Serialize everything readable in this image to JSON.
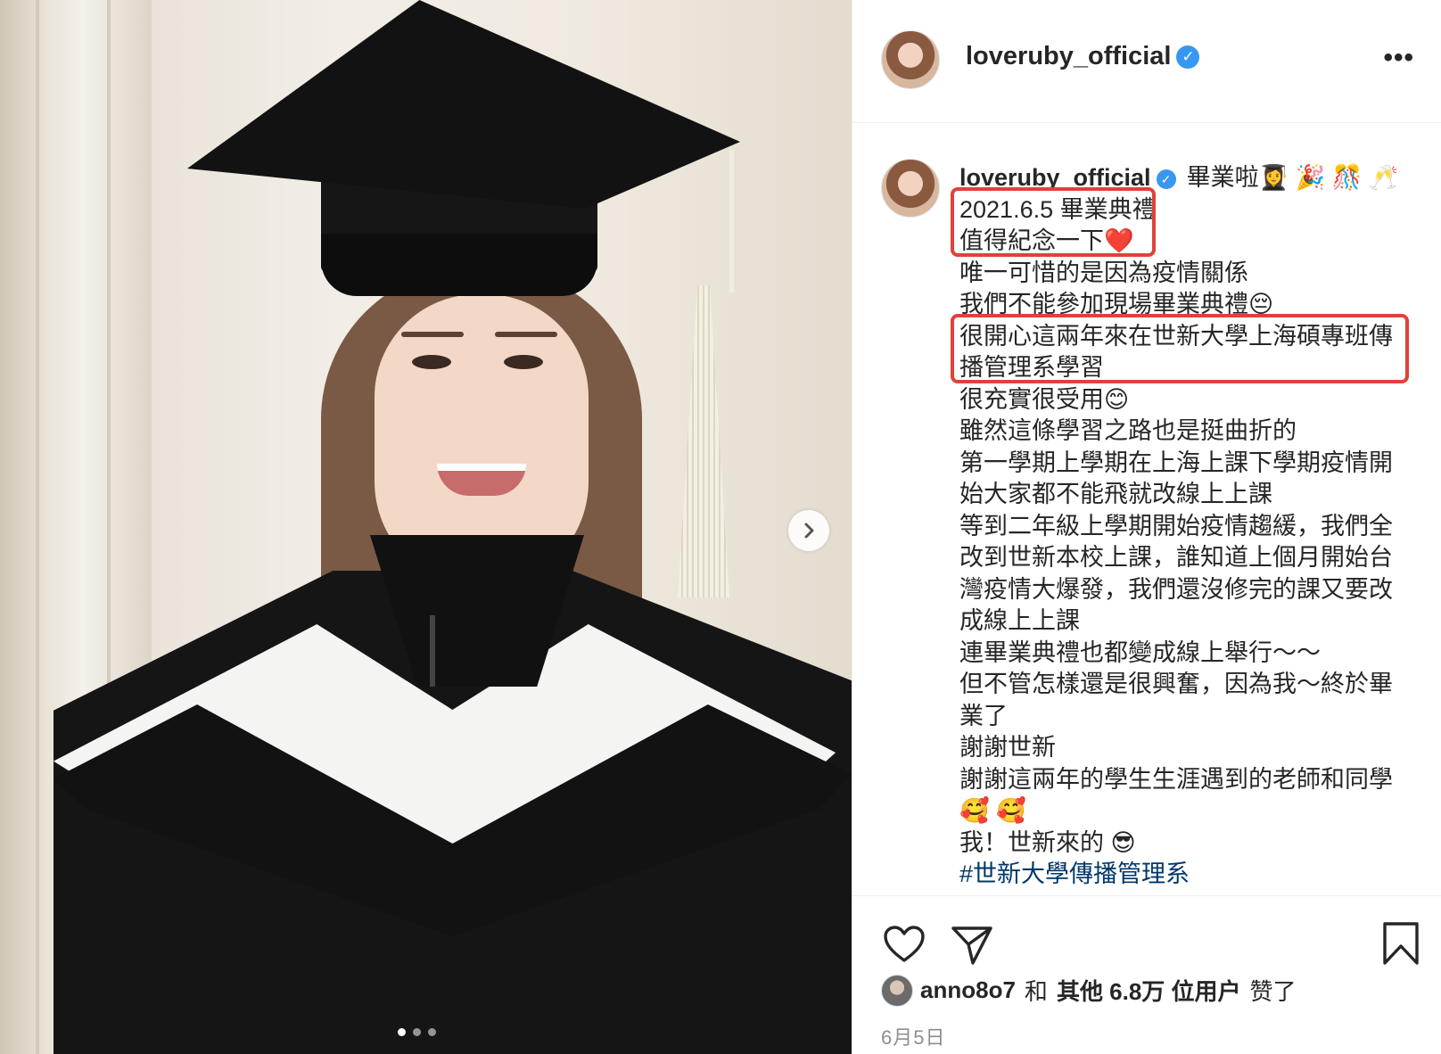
{
  "post": {
    "username": "loveruby_official",
    "verified_badge": "✓",
    "more_label": "•••",
    "caption_lines": [
      "2021.6.5 畢業典禮",
      "值得紀念一下❤️",
      "唯一可惜的是因為疫情關係",
      "我們不能參加現場畢業典禮😔",
      "很開心這兩年來在世新大學上海碩專班傳播管理系學習",
      "很充實很受用😊",
      "雖然這條學習之路也是挺曲折的",
      "第一學期上學期在上海上課下學期疫情開始大家都不能飛就改線上上課",
      "等到二年級上學期開始疫情趨緩，我們全改到世新本校上課，誰知道上個月開始台灣疫情大爆發，我們還沒修完的課又要改成線上上課",
      "連畢業典禮也都變成線上舉行～～",
      "但不管怎樣還是很興奮，因為我～終於畢業了",
      "謝謝世新",
      "謝謝這兩年的學生生涯遇到的老師和同學🥰 🥰",
      "我！世新來的 😎"
    ],
    "caption_first": "畢業啦👩‍🎓 🎉 🎊 🥂",
    "hashtag": "#世新大學傳播管理系",
    "likes": {
      "user": "anno8o7",
      "connector": "和",
      "others": "其他 6.8万 位用户",
      "suffix": "赞了"
    },
    "date": "6月5日"
  },
  "carousel": {
    "total": 3,
    "active_index": 0
  },
  "icons": {
    "next": "chevron-right-icon",
    "like": "heart-icon",
    "share": "paper-plane-icon",
    "save": "bookmark-icon",
    "verified": "verified-badge-icon",
    "more": "more-options-icon"
  },
  "colors": {
    "highlight_box": "#e0413a",
    "verified": "#3897f0",
    "hashtag": "#00376b"
  }
}
